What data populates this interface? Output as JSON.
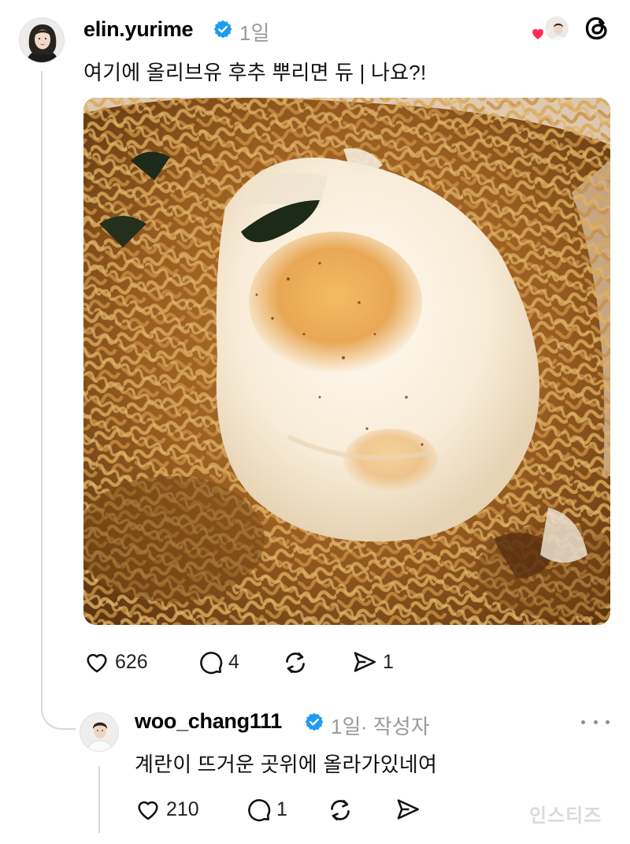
{
  "post": {
    "username": "elin.yurime",
    "time": "1일",
    "text": "여기에 올리브유 후추 뿌리면 듀 | 나요?!",
    "photo_alt": "fried-egg-ramen-photo",
    "likes": "626",
    "comments": "4",
    "reposts": "",
    "shares": "1"
  },
  "reply": {
    "username": "woo_chang111",
    "time": "1일",
    "author_tag": "· 작성자",
    "text": "계란이 뜨거운 곳위에 올라가있네여",
    "likes": "210",
    "comments": "1"
  },
  "watermark": "인스티즈",
  "icons": [
    "heart-icon",
    "comment-icon",
    "repost-icon",
    "share-icon",
    "verified-icon",
    "threads-logo-icon",
    "more-icon"
  ],
  "colors": {
    "verified": "#1d9bf0",
    "like_heart": "#ff2d55",
    "muted": "#9a9a9a"
  }
}
